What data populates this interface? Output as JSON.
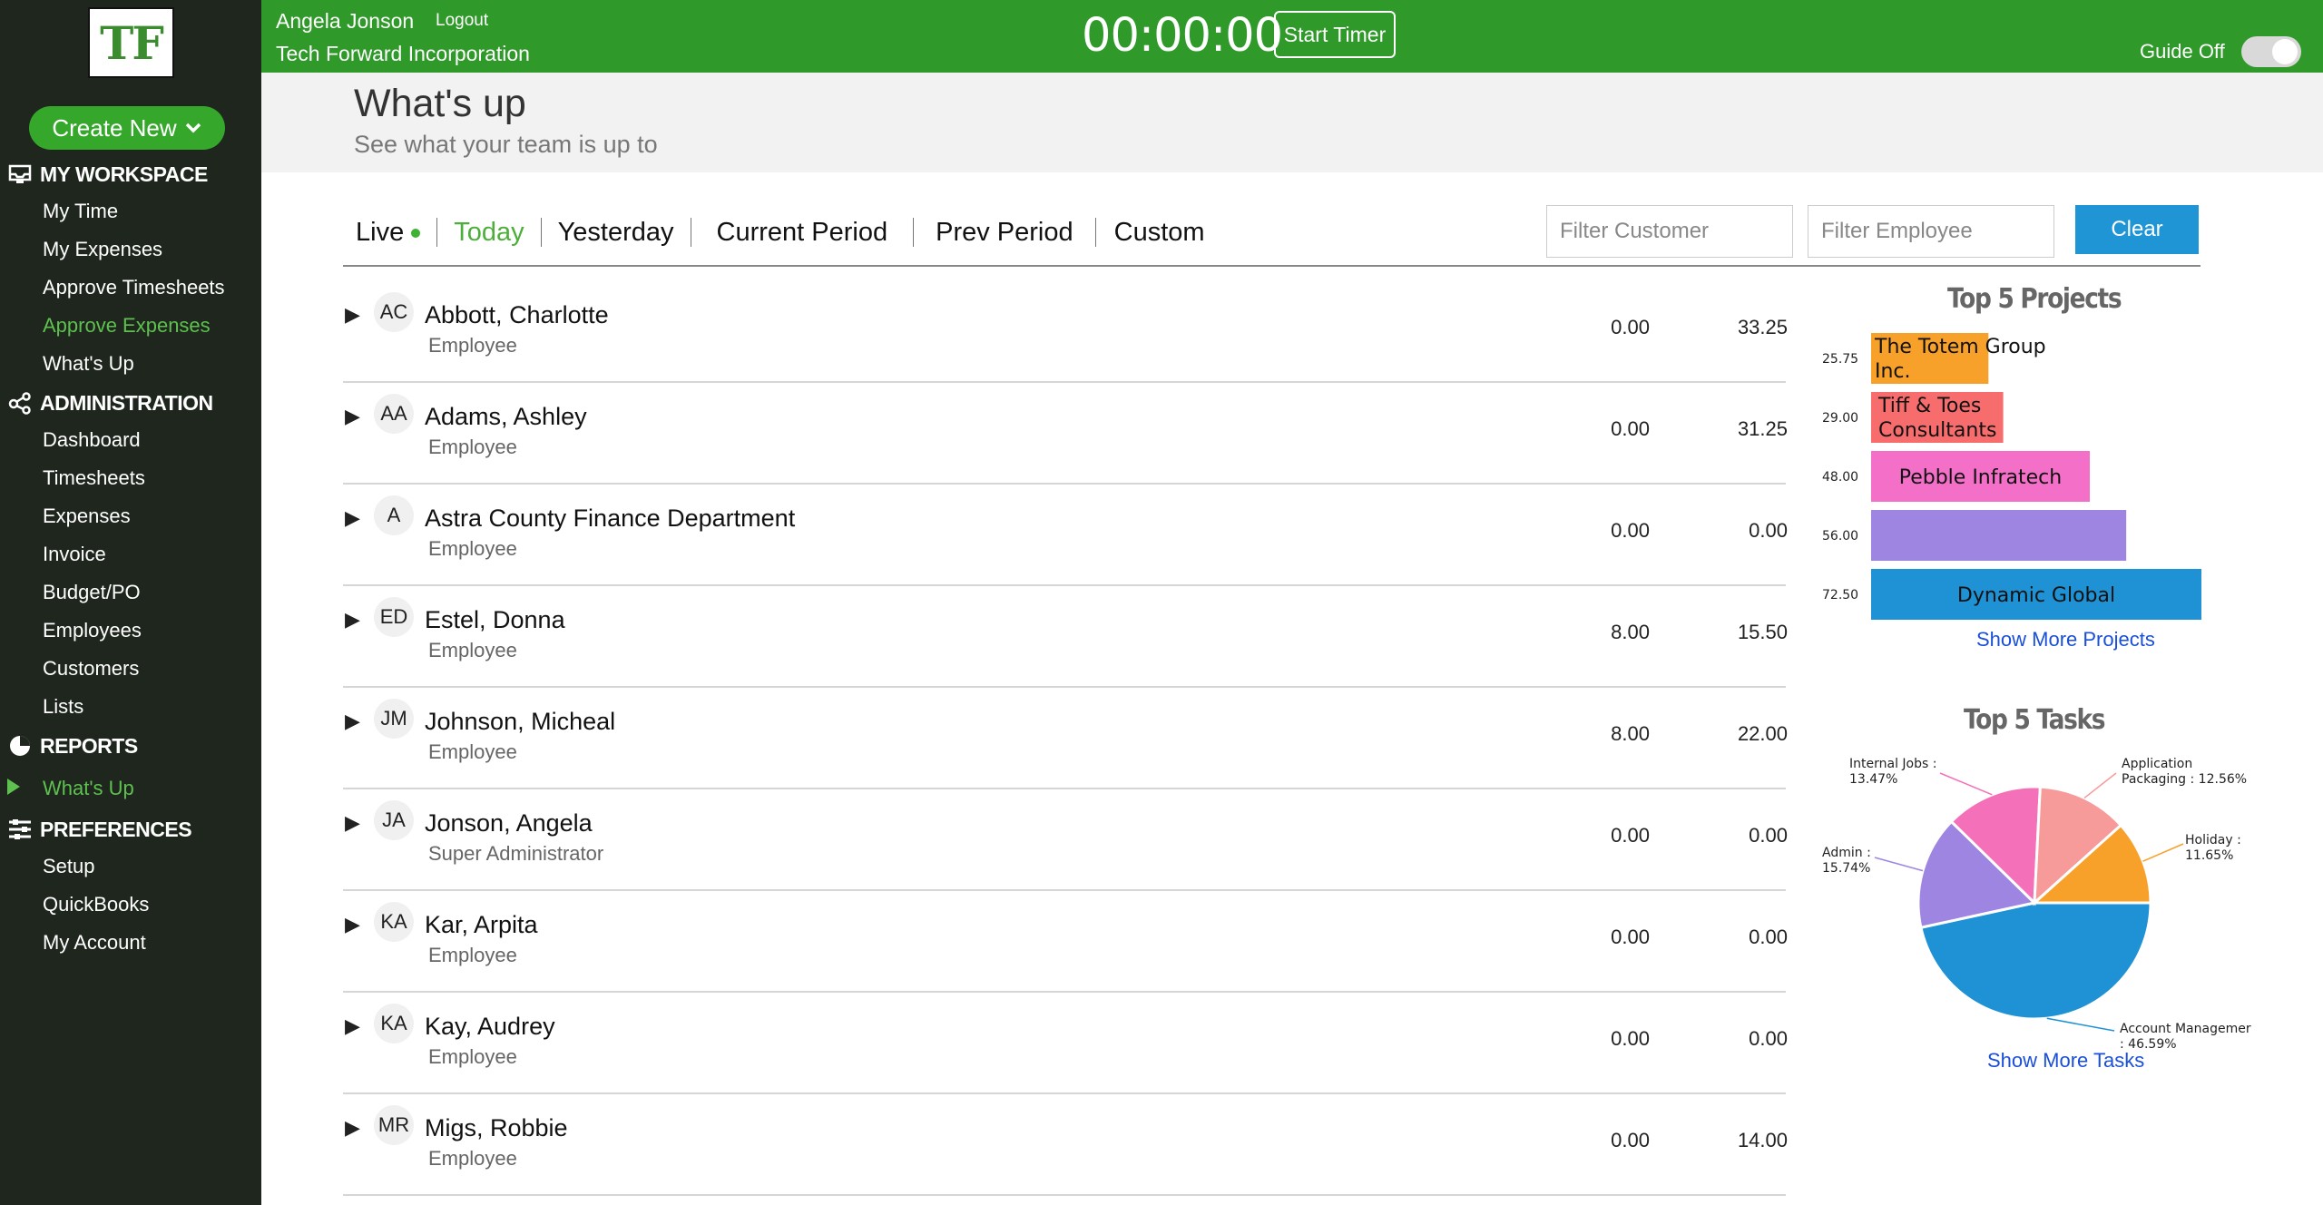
{
  "sidebar": {
    "logo": "TF",
    "create_new": "Create New",
    "sections": {
      "workspace": "MY WORKSPACE",
      "administration": "ADMINISTRATION",
      "reports": "REPORTS",
      "preferences": "PREFERENCES"
    },
    "workspace_items": [
      "My Time",
      "My Expenses",
      "Approve Timesheets",
      "Approve Expenses",
      "What's Up"
    ],
    "admin_items": [
      "Dashboard",
      "Timesheets",
      "Expenses",
      "Invoice",
      "Budget/PO",
      "Employees",
      "Customers",
      "Lists"
    ],
    "reports_items": [
      "What's Up"
    ],
    "pref_items": [
      "Setup",
      "QuickBooks",
      "My Account"
    ]
  },
  "topbar": {
    "user": "Angela Jonson",
    "logout": "Logout",
    "company": "Tech Forward Incorporation",
    "timer": "00:00:00",
    "start_timer": "Start Timer",
    "guide": "Guide Off"
  },
  "header": {
    "title": "What's up",
    "subtitle": "See what your team is up to"
  },
  "tabs": [
    "Live",
    "Today",
    "Yesterday",
    "Current Period",
    "Prev Period",
    "Custom"
  ],
  "filters": {
    "customer_placeholder": "Filter Customer",
    "employee_placeholder": "Filter Employee",
    "clear": "Clear"
  },
  "rows": [
    {
      "initials": "AC",
      "name": "Abbott, Charlotte",
      "role": "Employee",
      "v1": "0.00",
      "v2": "33.25"
    },
    {
      "initials": "AA",
      "name": "Adams, Ashley",
      "role": "Employee",
      "v1": "0.00",
      "v2": "31.25"
    },
    {
      "initials": "A",
      "name": "Astra County Finance Department",
      "role": "Employee",
      "v1": "0.00",
      "v2": "0.00"
    },
    {
      "initials": "ED",
      "name": "Estel, Donna",
      "role": "Employee",
      "v1": "8.00",
      "v2": "15.50"
    },
    {
      "initials": "JM",
      "name": "Johnson, Micheal",
      "role": "Employee",
      "v1": "8.00",
      "v2": "22.00"
    },
    {
      "initials": "JA",
      "name": "Jonson, Angela",
      "role": "Super Administrator",
      "v1": "0.00",
      "v2": "0.00"
    },
    {
      "initials": "KA",
      "name": "Kar, Arpita",
      "role": "Employee",
      "v1": "0.00",
      "v2": "0.00"
    },
    {
      "initials": "KA",
      "name": "Kay, Audrey",
      "role": "Employee",
      "v1": "0.00",
      "v2": "0.00"
    },
    {
      "initials": "MR",
      "name": "Migs, Robbie",
      "role": "Employee",
      "v1": "0.00",
      "v2": "14.00"
    }
  ],
  "chart_data": [
    {
      "type": "bar",
      "title": "Top 5 Projects",
      "orientation": "horizontal",
      "categories": [
        "The Totem Group Inc.",
        "Tiff & Toes Consultants",
        "Pebble Infratech",
        "",
        "Dynamic Global"
      ],
      "values": [
        25.75,
        29.0,
        48.0,
        56.0,
        72.5
      ],
      "value_labels": [
        "25.75",
        "29.00",
        "48.00",
        "56.00",
        "72.50"
      ],
      "colors": [
        "#f7a12a",
        "#f76d6d",
        "#f470c8",
        "#9d85e1",
        "#1e92d4"
      ],
      "xlim": [
        0,
        72.5
      ],
      "show_more": "Show More Projects"
    },
    {
      "type": "pie",
      "title": "Top 5 Tasks",
      "slices": [
        {
          "label": "Account Managemer",
          "value": 46.59,
          "text": "Account Managemer\n: 46.59%",
          "color": "#1e92d4"
        },
        {
          "label": "Admin",
          "value": 15.74,
          "text": "Admin :\n15.74%",
          "color": "#9d85e1"
        },
        {
          "label": "Internal Jobs",
          "value": 13.47,
          "text": "Internal Jobs :\n13.47%",
          "color": "#f470b8"
        },
        {
          "label": "Application Packaging",
          "value": 12.56,
          "text": "Application\nPackaging : 12.56%",
          "color": "#f79a9a"
        },
        {
          "label": "Holiday",
          "value": 11.65,
          "text": "Holiday :\n11.65%",
          "color": "#f7a12a"
        }
      ],
      "show_more": "Show More Tasks"
    }
  ]
}
